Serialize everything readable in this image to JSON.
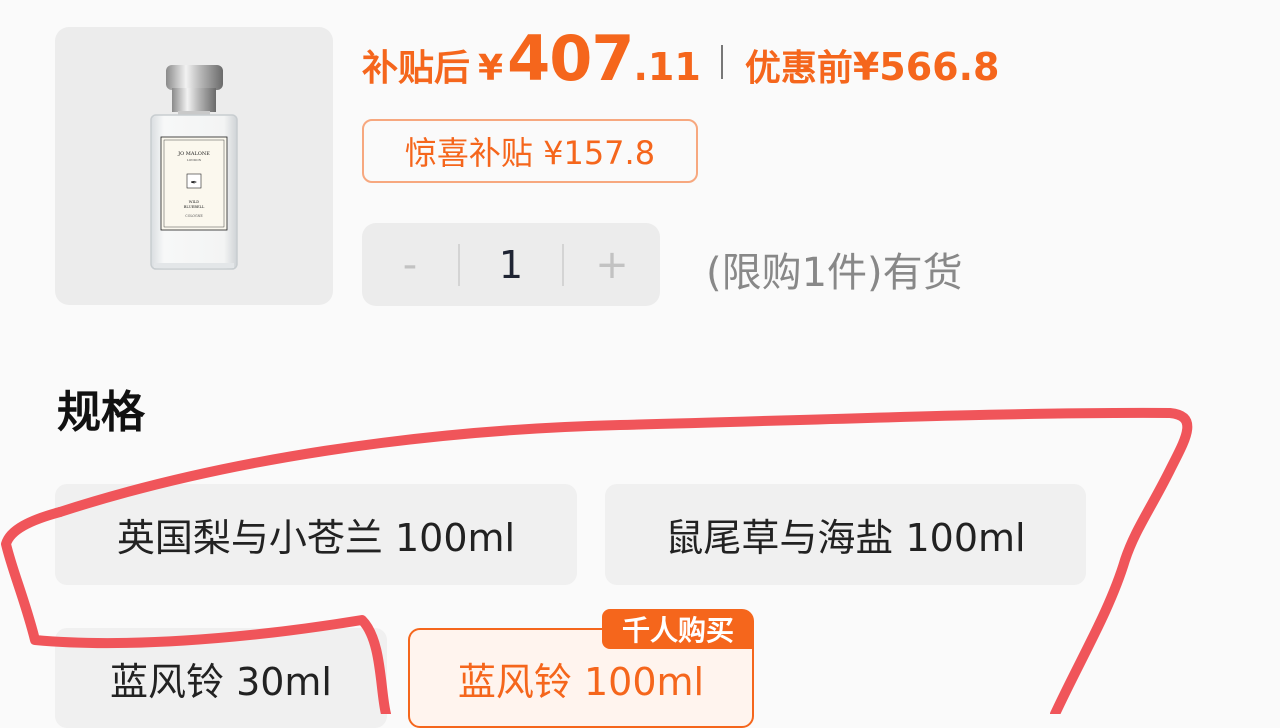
{
  "product": {
    "image_brand": "JO MALONE",
    "image_sub": "LONDON",
    "image_name1": "WILD",
    "image_name2": "BLUEBELL",
    "image_name3": "COLOGNE"
  },
  "price": {
    "after_label": "补贴后",
    "currency": "¥",
    "after_int": "407",
    "after_dec": ".11",
    "before_label": "优惠前",
    "before_value": "¥566.8"
  },
  "subsidy_badge": "惊喜补贴 ¥157.8",
  "quantity": {
    "minus": "-",
    "value": "1",
    "plus": "+"
  },
  "stock_text": "(限购1件)有货",
  "spec": {
    "title": "规格",
    "options": [
      {
        "label": "英国梨与小苍兰 100ml",
        "selected": false
      },
      {
        "label": "鼠尾草与海盐 100ml",
        "selected": false
      },
      {
        "label": "蓝风铃 30ml",
        "selected": false
      },
      {
        "label": "蓝风铃 100ml",
        "selected": true,
        "tag": "千人购买"
      }
    ]
  },
  "colors": {
    "accent": "#f5661c",
    "annotation": "#f0555a"
  }
}
